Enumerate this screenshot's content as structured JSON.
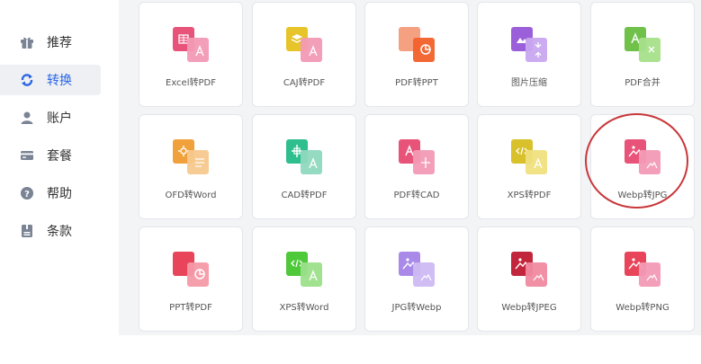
{
  "sidebar": {
    "items": [
      {
        "label": "推荐",
        "icon": "grid-gift-icon",
        "active": false
      },
      {
        "label": "转换",
        "icon": "refresh-icon",
        "active": true
      },
      {
        "label": "账户",
        "icon": "user-icon",
        "active": false
      },
      {
        "label": "套餐",
        "icon": "card-icon",
        "active": false
      },
      {
        "label": "帮助",
        "icon": "question-icon",
        "active": false
      },
      {
        "label": "条款",
        "icon": "document-icon",
        "active": false
      }
    ]
  },
  "tools": [
    {
      "label": "Excel转PDF",
      "icon": "excel-to-pdf-icon",
      "back": "#e8537a",
      "front": "#f39ab5",
      "glyph": "grid"
    },
    {
      "label": "CAJ转PDF",
      "icon": "caj-to-pdf-icon",
      "back": "#e6c42a",
      "front": "#f39ab5",
      "glyph": "layers"
    },
    {
      "label": "PDF转PPT",
      "icon": "pdf-to-ppt-icon",
      "back": "#f5a081",
      "front": "#f2612b",
      "glyph": "pie"
    },
    {
      "label": "图片压缩",
      "icon": "image-compress-icon",
      "back": "#9b5fd9",
      "front": "#c9a8f0",
      "glyph": "compress"
    },
    {
      "label": "PDF合并",
      "icon": "pdf-merge-icon",
      "back": "#6fc14a",
      "front": "#a6e08a",
      "glyph": "merge"
    },
    {
      "label": "OFD转Word",
      "icon": "ofd-to-word-icon",
      "back": "#f0a13c",
      "front": "#f7c98e",
      "glyph": "gear"
    },
    {
      "label": "CAD转PDF",
      "icon": "cad-to-pdf-icon",
      "back": "#2fbf8e",
      "front": "#8fd9bf",
      "glyph": "cross"
    },
    {
      "label": "PDF转CAD",
      "icon": "pdf-to-cad-icon",
      "back": "#e8537a",
      "front": "#f39ab5",
      "glyph": "pdfcad"
    },
    {
      "label": "XPS转PDF",
      "icon": "xps-to-pdf-icon",
      "back": "#d8c12a",
      "front": "#efe07e",
      "glyph": "code"
    },
    {
      "label": "Webp转JPG",
      "icon": "webp-to-jpg-icon",
      "back": "#e8537a",
      "front": "#f39ab5",
      "glyph": "image"
    },
    {
      "label": "PPT转PDF",
      "icon": "ppt-to-pdf-icon",
      "back": "#e8455a",
      "front": "#f59aa8",
      "glyph": "pie"
    },
    {
      "label": "XPS转Word",
      "icon": "xps-to-word-icon",
      "back": "#4fc93a",
      "front": "#9be08a",
      "glyph": "code"
    },
    {
      "label": "JPG转Webp",
      "icon": "jpg-to-webp-icon",
      "back": "#a98ae8",
      "front": "#cdb9f3",
      "glyph": "image"
    },
    {
      "label": "Webp转JPEG",
      "icon": "webp-to-jpeg-icon",
      "back": "#c2263c",
      "front": "#f08aa0",
      "glyph": "image"
    },
    {
      "label": "Webp转PNG",
      "icon": "webp-to-png-icon",
      "back": "#e8455a",
      "front": "#f39ab5",
      "glyph": "image"
    }
  ],
  "colors": {
    "accent": "#2a66e2",
    "highlight_ring": "#c8373a"
  }
}
